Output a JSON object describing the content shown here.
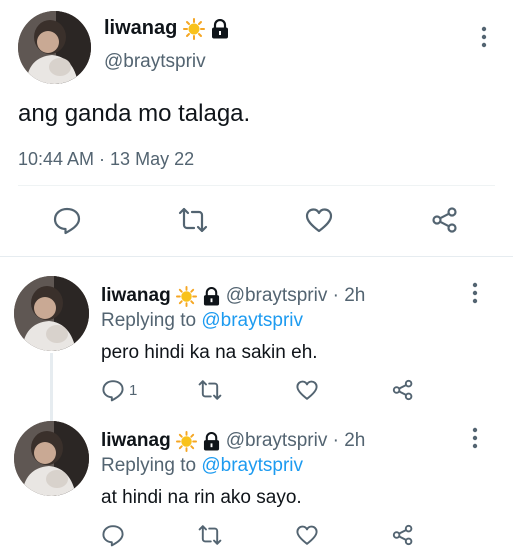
{
  "main_tweet": {
    "display_name": "liwanag",
    "handle": "@braytspriv",
    "text": "ang ganda mo talaga.",
    "timestamp": "10:44 AM · 13 May 22",
    "name_emoji": "sun-emoji",
    "protected_icon": "lock-icon"
  },
  "replies": [
    {
      "display_name": "liwanag",
      "handle_time": "@braytspriv · 2h",
      "replying_prefix": "Replying to",
      "replying_to": "@braytspriv",
      "text": "pero hindi ka na sakin eh.",
      "reply_count": "1"
    },
    {
      "display_name": "liwanag",
      "handle_time": "@braytspriv · 2h",
      "replying_prefix": "Replying to",
      "replying_to": "@braytspriv",
      "text": "at hindi na rin ako sayo.",
      "reply_count": ""
    }
  ],
  "colors": {
    "text": "#0f1419",
    "secondary": "#536471",
    "link": "#1d9bf0",
    "divider": "#e6ecf0"
  }
}
